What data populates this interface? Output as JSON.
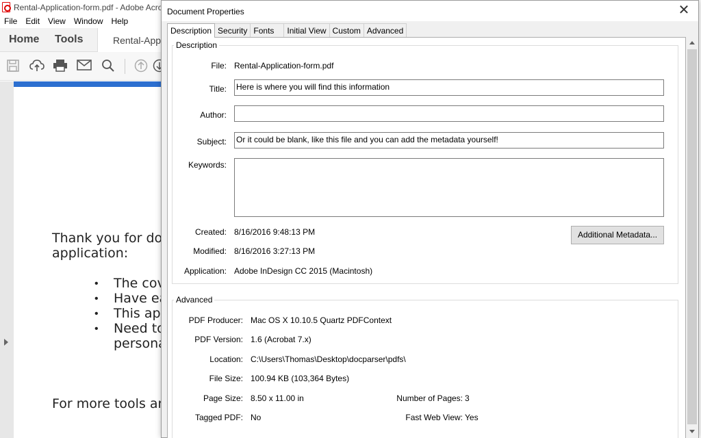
{
  "background": {
    "window_title": "Rental-Application-form.pdf - Adobe Acrob",
    "menu": [
      "File",
      "Edit",
      "View",
      "Window",
      "Help"
    ],
    "tabs": {
      "home": "Home",
      "tools": "Tools",
      "document": "Rental-Appl"
    },
    "page_lines": {
      "line1": "Thank you for dow",
      "line2": "application:",
      "bullet1": "The cove",
      "bullet2": "Have ea",
      "bullet3": "This app",
      "bullet4": "Need to",
      "bullet4b": "persona",
      "footer": "For more tools and"
    },
    "accent_color": "#2c6fd0"
  },
  "dialog": {
    "title": "Document Properties",
    "tabs": [
      "Description",
      "Security",
      "Fonts",
      "Initial View",
      "Custom",
      "Advanced"
    ],
    "active_tab": "Description",
    "description": {
      "group_title": "Description",
      "file_label": "File:",
      "file_value": "Rental-Application-form.pdf",
      "title_label": "Title:",
      "title_value": "Here is where you will find this information",
      "author_label": "Author:",
      "author_value": "",
      "subject_label": "Subject:",
      "subject_value": "Or it could be blank, like this file and you can add the metadata yourself!",
      "keywords_label": "Keywords:",
      "keywords_value": "",
      "created_label": "Created:",
      "created_value": "8/16/2016 9:48:13 PM",
      "modified_label": "Modified:",
      "modified_value": "8/16/2016 3:27:13 PM",
      "application_label": "Application:",
      "application_value": "Adobe InDesign CC 2015 (Macintosh)",
      "additional_metadata_button": "Additional Metadata..."
    },
    "advanced": {
      "group_title": "Advanced",
      "producer_label": "PDF Producer:",
      "producer_value": "Mac OS X 10.10.5 Quartz PDFContext",
      "version_label": "PDF Version:",
      "version_value": "1.6 (Acrobat 7.x)",
      "location_label": "Location:",
      "location_value": "C:\\Users\\Thomas\\Desktop\\docparser\\pdfs\\",
      "filesize_label": "File Size:",
      "filesize_value": "100.94 KB (103,364 Bytes)",
      "pagesize_label": "Page Size:",
      "pagesize_value": "8.50 x 11.00 in",
      "pages_label": "Number of Pages:",
      "pages_value": "3",
      "tagged_label": "Tagged PDF:",
      "tagged_value": "No",
      "fastweb_label": "Fast Web View:",
      "fastweb_value": "Yes"
    }
  }
}
